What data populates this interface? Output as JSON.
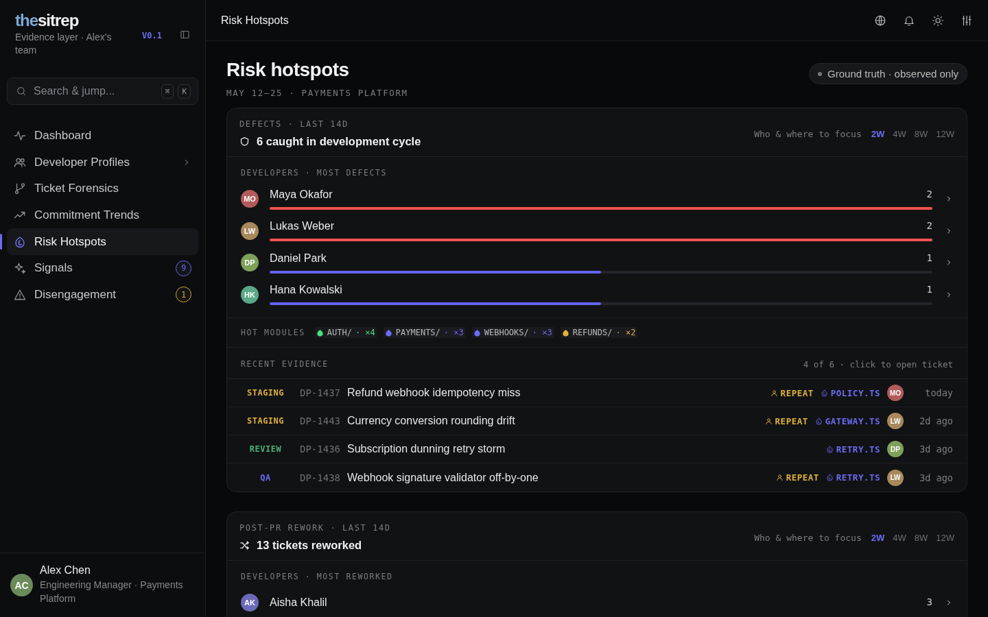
{
  "sidebar": {
    "logo": {
      "lead": "the",
      "rest": "sitrep"
    },
    "subtitle": "Evidence layer · Alex's team",
    "version": "V0.1",
    "search": {
      "placeholder": "Search & jump...",
      "keys": [
        "⌘",
        "K"
      ]
    },
    "items": [
      {
        "label": "Dashboard",
        "selected": false
      },
      {
        "label": "Developer Profiles",
        "selected": false,
        "submenu": true
      },
      {
        "label": "Ticket Forensics",
        "selected": false
      },
      {
        "label": "Commitment Trends",
        "selected": false
      },
      {
        "label": "Risk Hotspots",
        "selected": true
      },
      {
        "label": "Signals",
        "selected": false,
        "badge": "9",
        "color": "#6366f1"
      },
      {
        "label": "Disengagement",
        "selected": false,
        "badge": "1",
        "color": "#d4a72c"
      }
    ],
    "user": {
      "initials": "AC",
      "color": "#6b8a5a",
      "name": "Alex Chen",
      "role": "Engineering Manager · Payments Platform"
    }
  },
  "topbar": {
    "title": "Risk Hotspots"
  },
  "page": {
    "title": "Risk hotspots",
    "subtitle": "MAY 12–25 · PAYMENTS PLATFORM",
    "pill": "Ground truth · observed only"
  },
  "cards": [
    {
      "eyebrow": "DEFECTS · LAST 14D",
      "headline": "6 caught in development cycle",
      "focus": "Who & where to focus",
      "ranges": [
        {
          "label": "2W",
          "selected": true
        },
        {
          "label": "4W",
          "selected": false
        },
        {
          "label": "8W",
          "selected": false
        },
        {
          "label": "12W",
          "selected": false
        }
      ],
      "developers_heading": "DEVELOPERS · MOST DEFECTS",
      "developers": [
        {
          "avatar": {
            "initials": "MO",
            "color": "#b25b5b"
          },
          "name": "Maya Okafor",
          "count": "2",
          "bar": {
            "level": 1,
            "color": "#ef5350"
          }
        },
        {
          "avatar": {
            "initials": "LW",
            "color": "#a8895c"
          },
          "name": "Lukas Weber",
          "count": "2",
          "bar": {
            "level": 1,
            "color": "#ef5350"
          }
        },
        {
          "avatar": {
            "initials": "DP",
            "color": "#7ea05a"
          },
          "name": "Daniel Park",
          "count": "1",
          "bar": {
            "level": 0.5,
            "color": "#6363f0"
          }
        },
        {
          "avatar": {
            "initials": "HK",
            "color": "#5aa887"
          },
          "name": "Hana Kowalski",
          "count": "1",
          "bar": {
            "level": 0.5,
            "color": "#6363f0"
          }
        }
      ],
      "hot_modules": {
        "label": "HOT MODULES",
        "modules": [
          {
            "name": "AUTH/",
            "count": "· ×4",
            "color": "#4ade80"
          },
          {
            "name": "PAYMENTS/",
            "count": "· ×3",
            "color": "#6c6cf5"
          },
          {
            "name": "WEBHOOKS/",
            "count": "· ×3",
            "color": "#6c6cf5"
          },
          {
            "name": "REFUNDS/",
            "count": "· ×2",
            "color": "#e0b23a"
          }
        ]
      },
      "evidence": {
        "heading": "RECENT EVIDENCE",
        "note": "4 of 6 · click to open ticket",
        "rows": [
          {
            "stage": "STAGING",
            "color": "#e0b23a",
            "id": "DP-1437",
            "title": "Refund webhook idempotency miss",
            "repeat": "REPEAT",
            "file": "POLICY.TS",
            "avatar": {
              "initials": "MO",
              "color": "#b25b5b"
            },
            "time": "today"
          },
          {
            "stage": "STAGING",
            "color": "#e0b23a",
            "id": "DP-1443",
            "title": "Currency conversion rounding drift",
            "repeat": "REPEAT",
            "file": "GATEWAY.TS",
            "avatar": {
              "initials": "LW",
              "color": "#a8895c"
            },
            "time": "2d ago"
          },
          {
            "stage": "REVIEW",
            "color": "#4caf7a",
            "id": "DP-1436",
            "title": "Subscription dunning retry storm",
            "file": "RETRY.TS",
            "avatar": {
              "initials": "DP",
              "color": "#7ea05a"
            },
            "time": "3d ago"
          },
          {
            "stage": "QA",
            "color": "#6c6cf5",
            "id": "DP-1438",
            "title": "Webhook signature validator off-by-one",
            "repeat": "REPEAT",
            "file": "RETRY.TS",
            "avatar": {
              "initials": "LW",
              "color": "#a8895c"
            },
            "time": "3d ago"
          }
        ]
      }
    },
    {
      "eyebrow": "POST-PR REWORK · LAST 14D",
      "headline": "13 tickets reworked",
      "focus": "Who & where to focus",
      "ranges": [
        {
          "label": "2W",
          "selected": true
        },
        {
          "label": "4W",
          "selected": false
        },
        {
          "label": "8W",
          "selected": false
        },
        {
          "label": "12W",
          "selected": false
        }
      ],
      "developers_heading": "DEVELOPERS · MOST REWORKED",
      "developers": [
        {
          "avatar": {
            "initials": "AK",
            "color": "#6a6ab8"
          },
          "name": "Aisha Khalil",
          "count": "3"
        }
      ]
    }
  ]
}
